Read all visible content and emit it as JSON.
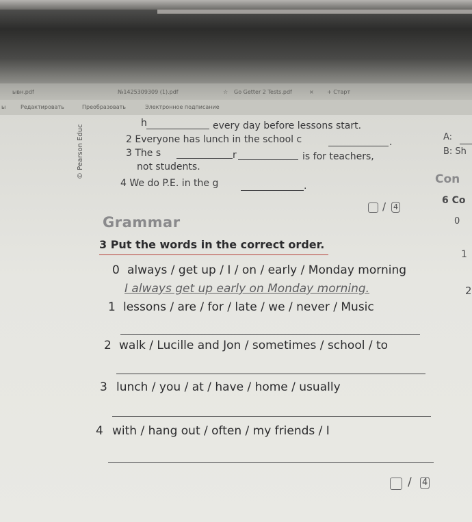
{
  "tabs": {
    "file1": "ывн.pdf",
    "file2": "№1425309309 (1).pdf",
    "star_label": "Go Getter 2 Tests.pdf",
    "tab_x": "×",
    "plus": "+ Старт"
  },
  "toolbar": {
    "edge": "ы",
    "edit": "Редактировать",
    "convert": "Преобразовать",
    "sign": "Электронное подписание"
  },
  "side": {
    "publisher": "© Pearson Educ"
  },
  "ex_top": {
    "line0_h": "h",
    "line0_rest": "every day before lessons start.",
    "line2_start": "2  Everyone has lunch in the school c",
    "line2_end": ".",
    "line3_start": "3  The s",
    "line3_r": "r",
    "line3_end": "is for teachers,",
    "line3_cont": "not students.",
    "line4_start": "4  We do P.E. in the g",
    "line4_end": "."
  },
  "score1": {
    "total": "4",
    "slash": "/"
  },
  "grammar": {
    "heading": "Grammar",
    "instruction": "3  Put the words in the correct order.",
    "items": [
      {
        "num": "0",
        "words": "always / get up / I / on / early / Monday morning"
      },
      {
        "num": "1",
        "words": "lessons / are / for / late / we / never / Music"
      },
      {
        "num": "2",
        "words": "walk / Lucille and Jon / sometimes / school / to"
      },
      {
        "num": "3",
        "words": "lunch / you / at / have / home / usually"
      },
      {
        "num": "4",
        "words": "with / hang out / often / my friends / I"
      }
    ],
    "example_answer": "I always get up early on Monday morning."
  },
  "score2": {
    "total": "4",
    "slash": "/"
  },
  "right_col": {
    "a": "A:",
    "b": "B: Sh",
    "con": "Con",
    "six": "6  Co",
    "zero": "0",
    "one": "1",
    "two": "2"
  }
}
